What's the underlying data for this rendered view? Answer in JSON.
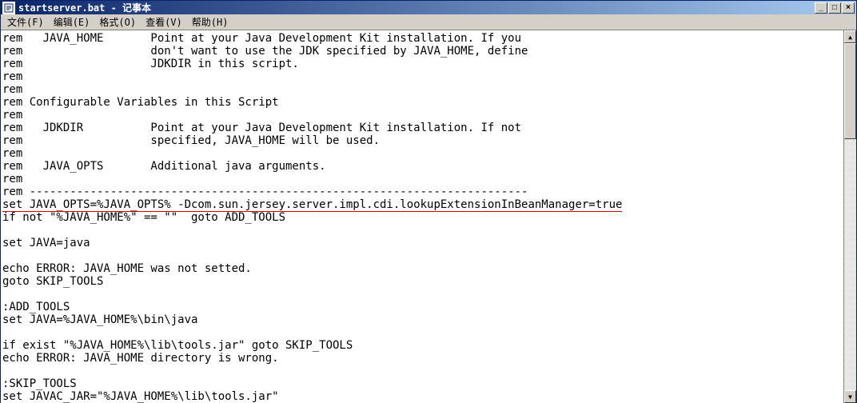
{
  "window": {
    "title": "startserver.bat - 记事本"
  },
  "menu": {
    "file": "文件(F)",
    "edit": "编辑(E)",
    "format": "格式(O)",
    "view": "查看(V)",
    "help": "帮助(H)"
  },
  "titlebar_buttons": {
    "minimize": "_",
    "maximize": "□",
    "close": "×"
  },
  "lines": [
    "rem   JAVA_HOME       Point at your Java Development Kit installation. If you",
    "rem                   don't want to use the JDK specified by JAVA_HOME, define",
    "rem                   JDKDIR in this script.",
    "rem",
    "rem",
    "rem Configurable Variables in this Script",
    "rem",
    "rem   JDKDIR          Point at your Java Development Kit installation. If not",
    "rem                   specified, JAVA_HOME will be used.",
    "rem",
    "rem   JAVA_OPTS       Additional java arguments.",
    "rem",
    "rem --------------------------------------------------------------------------",
    "set JAVA_OPTS=%JAVA_OPTS% -Dcom.sun.jersey.server.impl.cdi.lookupExtensionInBeanManager=true",
    "if not \"%JAVA_HOME%\" == \"\"  goto ADD_TOOLS",
    "",
    "set JAVA=java",
    "",
    "echo ERROR: JAVA_HOME was not setted.",
    "goto SKIP_TOOLS",
    "",
    ":ADD_TOOLS",
    "set JAVA=%JAVA_HOME%\\bin\\java",
    "",
    "if exist \"%JAVA_HOME%\\lib\\tools.jar\" goto SKIP_TOOLS",
    "echo ERROR: JAVA_HOME directory is wrong.",
    "",
    ":SKIP_TOOLS",
    "set JAVAC_JAR=\"%JAVA_HOME%\\lib\\tools.jar\""
  ],
  "underlined_line_index": 13
}
